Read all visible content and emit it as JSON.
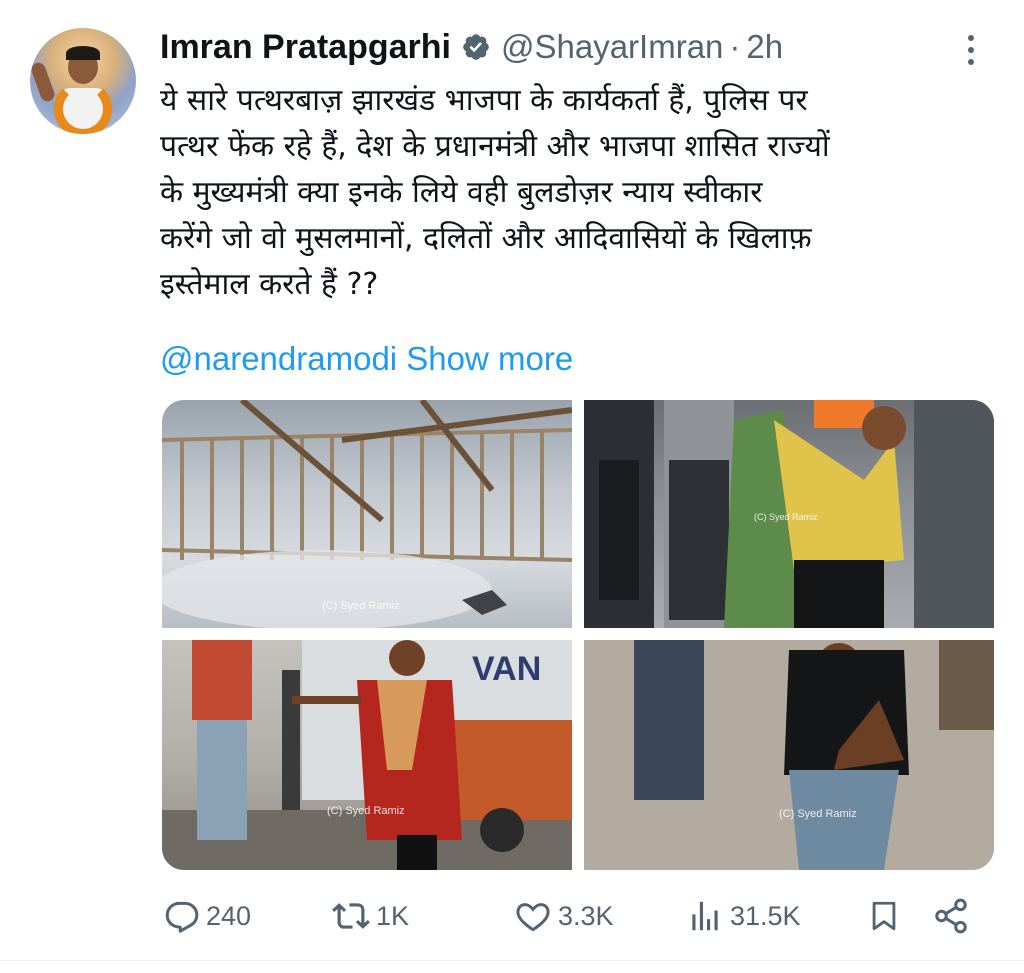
{
  "author": {
    "name": "Imran Pratapgarhi",
    "handle": "@ShayarImran",
    "separator": "·",
    "time": "2h",
    "verified_icon": "verified-badge-icon",
    "avatar_icon": "profile-avatar"
  },
  "tweet": {
    "lines": [
      "ये सारे पत्थरबाज़ झारखंड भाजपा के कार्यकर्ता हैं, पुलिस पर",
      "पत्थर फेंक रहे हैं, देश के प्रधानमंत्री और भाजपा शासित राज्यों",
      "के मुख्यमंत्री क्या इनके लिये वही बुलडोज़र न्याय स्वीकार",
      "करेंगे जो वो मुसलमानों, दलितों और आदिवासियों के खिलाफ़",
      "इस्तेमाल करते हैं ??"
    ],
    "mention": "@narendramodi",
    "show_more": "Show more"
  },
  "media": {
    "photos": [
      {
        "desc_icon": "photo-barricade",
        "watermark": "(C) Syed Ramiz"
      },
      {
        "desc_icon": "photo-man-yellow-shirt",
        "watermark": "(C) Syed Ramiz"
      },
      {
        "desc_icon": "photo-man-red-kurta",
        "watermark": "(C) Syed Ramiz"
      },
      {
        "desc_icon": "photo-man-black-tshirt",
        "watermark": "(C) Syed Ramiz"
      }
    ],
    "truck_text": "VAN"
  },
  "actions": {
    "replies": "240",
    "reposts": "1K",
    "likes": "3.3K",
    "views": "31.5K"
  },
  "colors": {
    "text": "#0f1419",
    "secondary": "#536471",
    "link": "#1d9bf0"
  }
}
